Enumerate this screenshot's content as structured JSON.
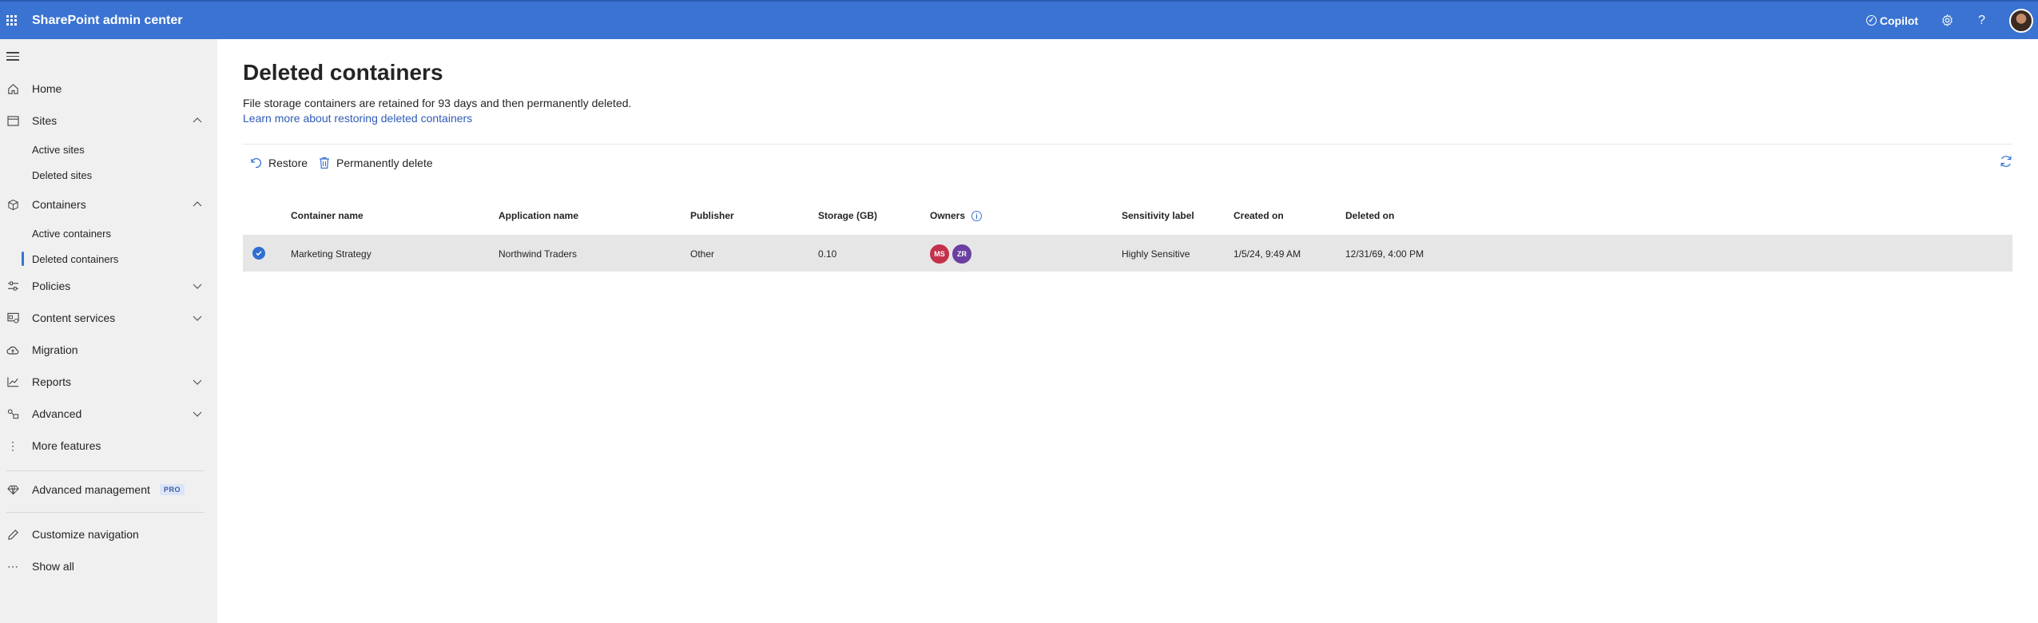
{
  "topbar": {
    "app_title": "SharePoint admin center",
    "copilot_label": "Copilot",
    "icons": [
      "waffle-icon",
      "copilot-icon",
      "gear-icon",
      "help-icon",
      "avatar"
    ]
  },
  "sidebar": {
    "items": [
      {
        "label": "Home",
        "icon": "home-icon"
      },
      {
        "label": "Sites",
        "icon": "sites-icon",
        "expanded": true
      },
      {
        "label": "Active sites"
      },
      {
        "label": "Deleted sites"
      },
      {
        "label": "Containers",
        "icon": "containers-icon",
        "expanded": true
      },
      {
        "label": "Active containers"
      },
      {
        "label": "Deleted containers",
        "selected": true
      },
      {
        "label": "Policies",
        "icon": "policies-icon",
        "expanded": false
      },
      {
        "label": "Content services",
        "icon": "content-services-icon",
        "expanded": false
      },
      {
        "label": "Migration",
        "icon": "migration-icon"
      },
      {
        "label": "Reports",
        "icon": "reports-icon",
        "expanded": false
      },
      {
        "label": "Advanced",
        "icon": "advanced-icon",
        "expanded": false
      },
      {
        "label": "More features",
        "icon": "more-features-icon"
      },
      {
        "label": "Advanced management",
        "icon": "diamond-icon",
        "badge": "PRO"
      },
      {
        "label": "Customize navigation",
        "icon": "pencil-icon"
      },
      {
        "label": "Show all",
        "icon": "ellipsis-icon"
      }
    ]
  },
  "main": {
    "title": "Deleted containers",
    "description": "File storage containers are retained for 93 days and then permanently deleted.",
    "learn_link": "Learn more about restoring deleted containers",
    "commands": {
      "restore": "Restore",
      "permanently_delete": "Permanently delete"
    },
    "table": {
      "columns": [
        "Container name",
        "Application name",
        "Publisher",
        "Storage (GB)",
        "Owners",
        "Sensitivity label",
        "Created on",
        "Deleted on"
      ],
      "rows": [
        {
          "container_name": "Marketing Strategy",
          "application_name": "Northwind Traders",
          "publisher": "Other",
          "storage": "0.10",
          "owners": [
            {
              "initials": "MS",
              "color": "#c4314b"
            },
            {
              "initials": "ZR",
              "color": "#6b3fa0"
            }
          ],
          "sensitivity_label": "Highly Sensitive",
          "created_on": "1/5/24, 9:49 AM",
          "deleted_on": "12/31/69, 4:00 PM",
          "selected": true
        }
      ]
    }
  },
  "colors": {
    "accent": "#3a73d1",
    "sidebar_bg": "#f0f0f0",
    "row_selected": "#e6e6e6"
  }
}
